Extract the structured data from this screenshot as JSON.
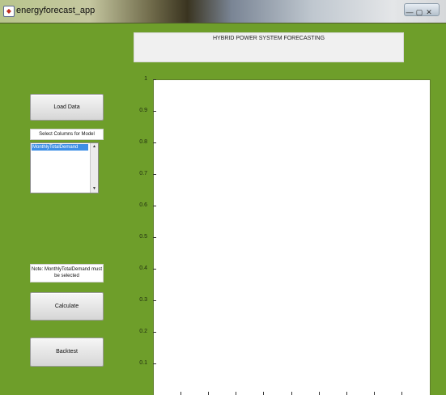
{
  "window": {
    "title": "energyforecast_app",
    "controls": [
      "—",
      "▢",
      "✕"
    ]
  },
  "header": {
    "title": "HYBRID POWER SYSTEM FORECASTING"
  },
  "left_panel": {
    "load_button": "Load Data",
    "select_label": "Select Columns for Model",
    "list_items": [
      "MonthlyTotalDemand"
    ],
    "note_line1": "Note: MonthlyTotalDemand",
    "note_line2": "must be selected",
    "calculate_button": "Calculate",
    "backtest_button": "Backtest"
  },
  "chart_data": {
    "type": "line",
    "title": "",
    "xlabel": "",
    "ylabel": "",
    "series": [],
    "ylim": [
      0,
      1
    ],
    "yticks": [
      "0.1",
      "0.2",
      "0.3",
      "0.4",
      "0.5",
      "0.6",
      "0.7",
      "0.8",
      "0.9",
      "1"
    ]
  },
  "colors": {
    "background": "#6e9e2a",
    "selection": "#3f8fe6"
  }
}
